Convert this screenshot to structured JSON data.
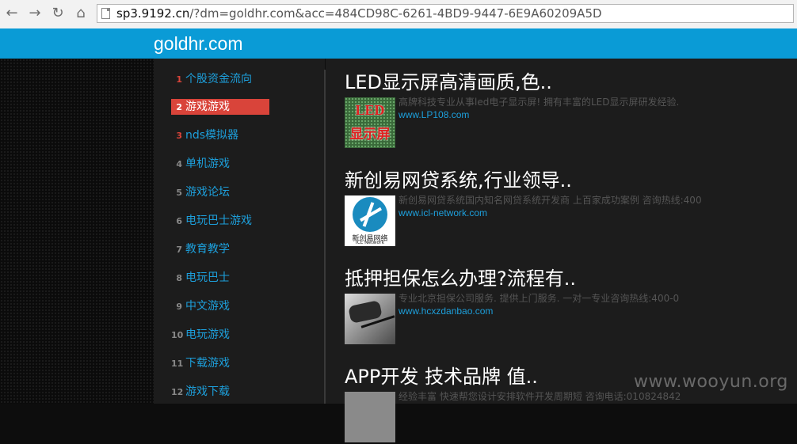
{
  "browser": {
    "back_icon": "arrow-left",
    "forward_icon": "arrow-right",
    "reload_icon": "reload",
    "home_icon": "home",
    "url_host": "sp3.9192.cn",
    "url_rest": "/?dm=goldhr.com&acc=484CD98C-6261-4BD9-9447-6E9A60209A5D"
  },
  "header": {
    "title": "goldhr.com",
    "color": "#0a9bd6"
  },
  "sidebar": {
    "items": [
      {
        "num": "1",
        "label": "个股资金流向",
        "num_color": "#d9443a"
      },
      {
        "num": "2",
        "label": "游戏游戏",
        "num_color": "#ffffff",
        "active": true
      },
      {
        "num": "3",
        "label": "nds模拟器",
        "num_color": "#d9443a"
      },
      {
        "num": "4",
        "label": "单机游戏",
        "num_color": "#888888"
      },
      {
        "num": "5",
        "label": "游戏论坛",
        "num_color": "#888888"
      },
      {
        "num": "6",
        "label": "电玩巴士游戏",
        "num_color": "#888888"
      },
      {
        "num": "7",
        "label": "教育教学",
        "num_color": "#888888"
      },
      {
        "num": "8",
        "label": "电玩巴士",
        "num_color": "#888888"
      },
      {
        "num": "9",
        "label": "中文游戏",
        "num_color": "#888888"
      },
      {
        "num": "10",
        "label": "电玩游戏",
        "num_color": "#888888"
      },
      {
        "num": "11",
        "label": "下载游戏",
        "num_color": "#888888"
      },
      {
        "num": "12",
        "label": "游戏下载",
        "num_color": "#888888"
      }
    ]
  },
  "ads": [
    {
      "title": "LED显示屏高清画质,色..",
      "desc": "高牌科技专业从事led电子显示屏! 拥有丰富的LED显示屏研发经验.",
      "link": "www.LP108.com",
      "thumb_line1": "LED",
      "thumb_line2": "显示屏"
    },
    {
      "title": "新创易网贷系统,行业领导..",
      "desc": "新创易网贷系统国内知名网贷系统开发商 上百家成功案例 咨询热线:400",
      "link": "www.icl-network.com",
      "thumb_line1": "新创易网络",
      "thumb_line2": "ICL Network"
    },
    {
      "title": "抵押担保怎么办理?流程有..",
      "desc": "专业北京担保公司服务. 提供上门服务. 一对一专业咨询热线:400-0",
      "link": "www.hcxzdanbao.com"
    },
    {
      "title": "APP开发 技术品牌 值..",
      "desc": "经验丰富 快速帮您设计安排软件开发周期短 咨询电话:010824842",
      "link": ""
    }
  ],
  "watermark": "www.wooyun.org"
}
